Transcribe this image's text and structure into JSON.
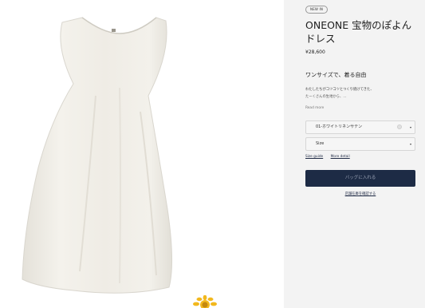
{
  "product": {
    "badge": "NEW IN",
    "title": "ONEONE 宝物のぽよんドレス",
    "price": "¥28,600",
    "tagline": "ワンサイズで、着る自由",
    "description_line1": "わたしたちがコツコツとつくり続けてきた、",
    "description_line2": "たーくさんの生地から、…",
    "read_more": "Read more"
  },
  "variant_select": {
    "selected": "01-ホワイトリネンサテン",
    "chevron": "▾"
  },
  "size_select": {
    "selected": "Size",
    "chevron": "▾"
  },
  "links": {
    "size_guide": "Size guide",
    "more_detail": "More detail"
  },
  "add_to_bag": "バッグに入れる",
  "store_link": "店舗在庫を確認する",
  "colors": {
    "button": "#1d2b45",
    "panel": "#f3f3f3"
  }
}
